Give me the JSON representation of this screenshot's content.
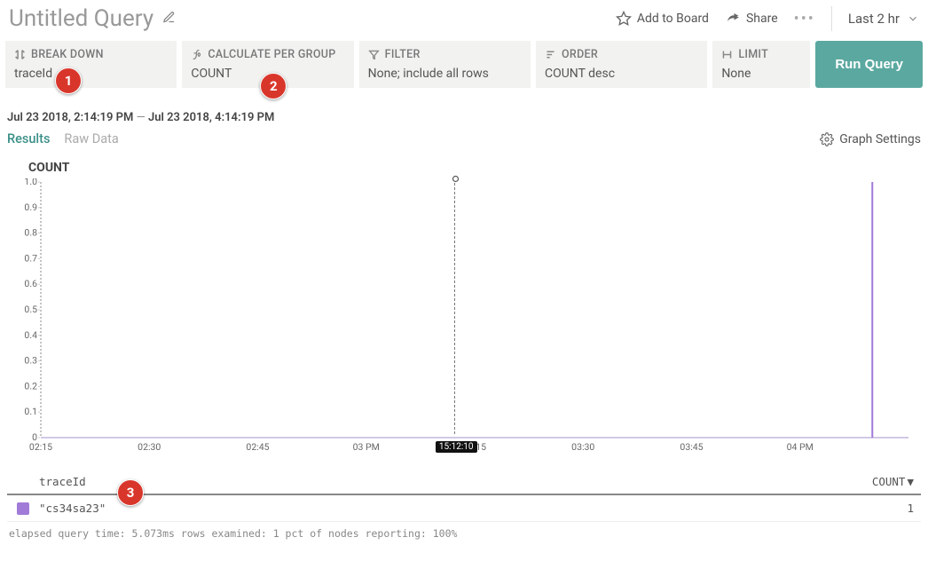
{
  "header": {
    "title": "Untitled Query",
    "add_to_board": "Add to Board",
    "share": "Share",
    "time_range_label": "Last 2 hr"
  },
  "query_builder": {
    "breakdown": {
      "label": "BREAK DOWN",
      "value": "traceId"
    },
    "calculate": {
      "label": "CALCULATE PER GROUP",
      "value": "COUNT"
    },
    "filter": {
      "label": "FILTER",
      "value": "None; include all rows"
    },
    "order": {
      "label": "ORDER",
      "value": "COUNT desc"
    },
    "limit": {
      "label": "LIMIT",
      "value": "None"
    },
    "run": "Run Query"
  },
  "annotations": {
    "b1": "1",
    "b2": "2",
    "b3": "3"
  },
  "timerange": {
    "from": "Jul 23 2018, 2:14:19 PM",
    "to": "Jul 23 2018, 4:14:19 PM"
  },
  "tabs": {
    "results": "Results",
    "raw": "Raw Data"
  },
  "graph_settings": "Graph Settings",
  "chart": {
    "title": "COUNT",
    "cursor_time": "15:12:10"
  },
  "table": {
    "col1": "traceId",
    "col2": "COUNT",
    "rows": [
      {
        "traceId": "\"cs34sa23\"",
        "count": "1"
      }
    ]
  },
  "footer": "elapsed query time: 5.073ms   rows examined: 1   pct of nodes reporting: 100%",
  "chart_data": {
    "type": "line",
    "title": "COUNT",
    "ylabel": "",
    "xlabel": "",
    "ylim": [
      0,
      1.0
    ],
    "y_ticks": [
      0,
      0.1,
      0.2,
      0.3,
      0.4,
      0.5,
      0.6,
      0.7,
      0.8,
      0.9,
      1.0
    ],
    "x_ticks": [
      "02:15",
      "02:30",
      "02:45",
      "03 PM",
      "03:15",
      "03:30",
      "03:45",
      "04 PM"
    ],
    "x_range_minutes": [
      135,
      255
    ],
    "series": [
      {
        "name": "\"cs34sa23\"",
        "color": "#a07bd8",
        "x_minutes": [
          250
        ],
        "values": [
          1
        ]
      }
    ],
    "cursor_at_x_minute": 192.17
  }
}
